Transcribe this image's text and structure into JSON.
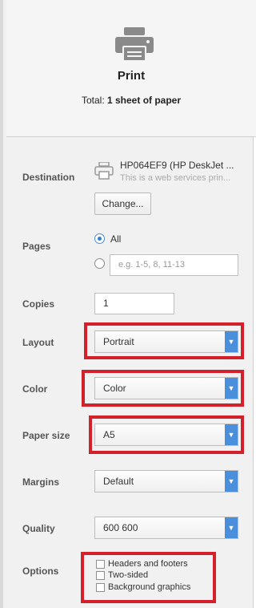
{
  "header": {
    "title": "Print",
    "total_prefix": "Total:",
    "total_value": "1 sheet of paper"
  },
  "destination": {
    "label": "Destination",
    "printer_name": "HP064EF9 (HP DeskJet ...",
    "printer_desc": "This is a web services prin...",
    "change_button": "Change..."
  },
  "pages": {
    "label": "Pages",
    "all_label": "All",
    "custom_placeholder": "e.g. 1-5, 8, 11-13",
    "selected": "All"
  },
  "copies": {
    "label": "Copies",
    "value": "1"
  },
  "layout": {
    "label": "Layout",
    "value": "Portrait"
  },
  "color": {
    "label": "Color",
    "value": "Color"
  },
  "paper_size": {
    "label": "Paper size",
    "value": "A5"
  },
  "margins": {
    "label": "Margins",
    "value": "Default"
  },
  "quality": {
    "label": "Quality",
    "value": "600 600"
  },
  "options": {
    "label": "Options",
    "items": [
      {
        "label": "Headers and footers",
        "checked": false
      },
      {
        "label": "Two-sided",
        "checked": false
      },
      {
        "label": "Background graphics",
        "checked": false
      }
    ]
  },
  "colors": {
    "highlight": "#d4202a",
    "accent": "#4a8fdb"
  },
  "icons": {
    "header": "printer-icon",
    "destination": "printer-icon",
    "dropdown": "chevron-down-icon"
  }
}
